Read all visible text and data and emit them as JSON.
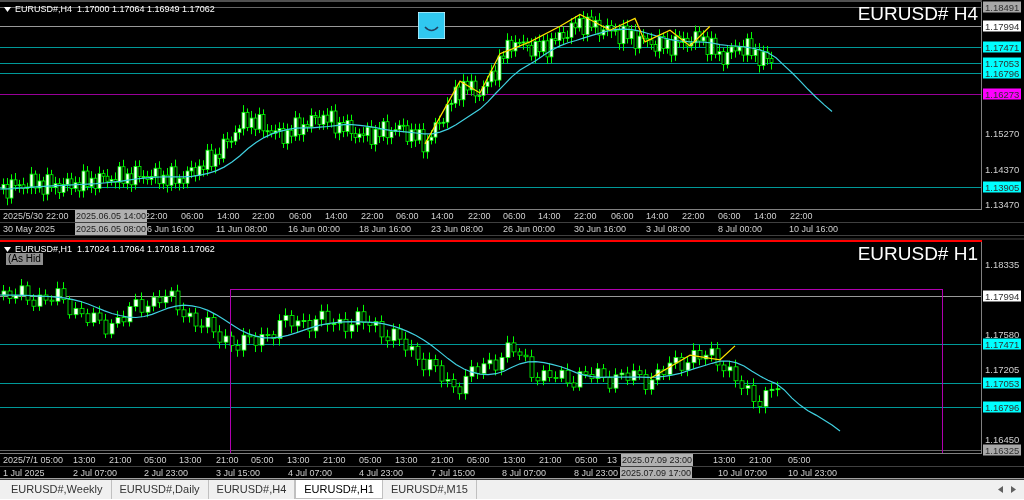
{
  "panes": [
    {
      "header": "EURUSD#,H4  1.17000 1.17064 1.16949 1.17062",
      "title": "EURUSD# H4",
      "active": false,
      "price_labels": [
        {
          "text": "1.18491",
          "kind": "box",
          "color": "#a8a8a8"
        },
        {
          "text": "1.17994",
          "kind": "box",
          "color": "#ffffff"
        },
        {
          "text": "1.17471",
          "kind": "box",
          "color": "#00ffff"
        },
        {
          "text": "1.17053",
          "kind": "box",
          "color": "#00ffff"
        },
        {
          "text": "1.16796",
          "kind": "box",
          "color": "#00ffff"
        },
        {
          "text": "1.16273",
          "kind": "box",
          "color": "#ff00ff"
        },
        {
          "text": "1.15270",
          "kind": "plain"
        },
        {
          "text": "1.14370",
          "kind": "plain"
        },
        {
          "text": "1.13905",
          "kind": "box",
          "color": "#00ffff"
        },
        {
          "text": "1.13470",
          "kind": "plain"
        }
      ],
      "time_rows": [
        [
          {
            "text": "2025/5/30",
            "kind": "plain"
          },
          {
            "text": "22:00",
            "kind": "plain"
          },
          {
            "text": "2025.06.05 14:00",
            "kind": "box"
          },
          {
            "text": "22:00",
            "kind": "plain"
          },
          {
            "text": "06:00",
            "kind": "plain"
          },
          {
            "text": "14:00",
            "kind": "plain"
          },
          {
            "text": "22:00",
            "kind": "plain"
          },
          {
            "text": "06:00",
            "kind": "plain"
          },
          {
            "text": "14:00",
            "kind": "plain"
          },
          {
            "text": "22:00",
            "kind": "plain"
          },
          {
            "text": "06:00",
            "kind": "plain"
          },
          {
            "text": "14:00",
            "kind": "plain"
          },
          {
            "text": "22:00",
            "kind": "plain"
          },
          {
            "text": "06:00",
            "kind": "plain"
          },
          {
            "text": "14:00",
            "kind": "plain"
          },
          {
            "text": "22:00",
            "kind": "plain"
          },
          {
            "text": "06:00",
            "kind": "plain"
          },
          {
            "text": "14:00",
            "kind": "plain"
          },
          {
            "text": "22:00",
            "kind": "plain"
          },
          {
            "text": "06:00",
            "kind": "plain"
          },
          {
            "text": "14:00",
            "kind": "plain"
          },
          {
            "text": "22:00",
            "kind": "plain"
          }
        ],
        [
          {
            "text": "30 May 2025",
            "kind": "plain"
          },
          {
            "text": "2025.06.05 08:00",
            "kind": "box"
          },
          {
            "text": "6 Jun 16:00",
            "kind": "plain"
          },
          {
            "text": "11 Jun 08:00",
            "kind": "plain"
          },
          {
            "text": "16 Jun 00:00",
            "kind": "plain"
          },
          {
            "text": "18 Jun 16:00",
            "kind": "plain"
          },
          {
            "text": "23 Jun 08:00",
            "kind": "plain"
          },
          {
            "text": "26 Jun 00:00",
            "kind": "plain"
          },
          {
            "text": "30 Jun 16:00",
            "kind": "plain"
          },
          {
            "text": "3 Jul 08:00",
            "kind": "plain"
          },
          {
            "text": "8 Jul 00:00",
            "kind": "plain"
          },
          {
            "text": "10 Jul 16:00",
            "kind": "plain"
          }
        ]
      ]
    },
    {
      "header": "EURUSD#,H1  1.17024 1.17064 1.17018 1.17062",
      "title": "EURUSD# H1",
      "active": true,
      "tag": "(As Hid",
      "price_labels": [
        {
          "text": "1.18335",
          "kind": "plain"
        },
        {
          "text": "1.17994",
          "kind": "box",
          "color": "#ffffff"
        },
        {
          "text": "1.17580",
          "kind": "plain"
        },
        {
          "text": "1.17471",
          "kind": "box",
          "color": "#00ffff"
        },
        {
          "text": "1.17205",
          "kind": "plain"
        },
        {
          "text": "1.17053",
          "kind": "box",
          "color": "#00ffff"
        },
        {
          "text": "1.16796",
          "kind": "box",
          "color": "#00ffff"
        },
        {
          "text": "1.16450",
          "kind": "plain"
        },
        {
          "text": "1.16325",
          "kind": "box",
          "color": "#a8a8a8"
        }
      ],
      "time_rows": [
        [
          {
            "text": "2025/7/1 05:00",
            "kind": "plain"
          },
          {
            "text": "13:00",
            "kind": "plain"
          },
          {
            "text": "21:00",
            "kind": "plain"
          },
          {
            "text": "05:00",
            "kind": "plain"
          },
          {
            "text": "13:00",
            "kind": "plain"
          },
          {
            "text": "21:00",
            "kind": "plain"
          },
          {
            "text": "05:00",
            "kind": "plain"
          },
          {
            "text": "13:00",
            "kind": "plain"
          },
          {
            "text": "21:00",
            "kind": "plain"
          },
          {
            "text": "05:00",
            "kind": "plain"
          },
          {
            "text": "13:00",
            "kind": "plain"
          },
          {
            "text": "21:00",
            "kind": "plain"
          },
          {
            "text": "05:00",
            "kind": "plain"
          },
          {
            "text": "13:00",
            "kind": "plain"
          },
          {
            "text": "21:00",
            "kind": "plain"
          },
          {
            "text": "05:00",
            "kind": "plain"
          },
          {
            "text": "13",
            "kind": "plain"
          },
          {
            "text": "2025.07.09 23:00",
            "kind": "box"
          },
          {
            "text": "13:00",
            "kind": "plain"
          },
          {
            "text": "21:00",
            "kind": "plain"
          },
          {
            "text": "05:00",
            "kind": "plain"
          }
        ],
        [
          {
            "text": "1 Jul 2025",
            "kind": "plain"
          },
          {
            "text": "2 Jul 07:00",
            "kind": "plain"
          },
          {
            "text": "2 Jul 23:00",
            "kind": "plain"
          },
          {
            "text": "3 Jul 15:00",
            "kind": "plain"
          },
          {
            "text": "4 Jul 07:00",
            "kind": "plain"
          },
          {
            "text": "4 Jul 23:00",
            "kind": "plain"
          },
          {
            "text": "7 Jul 15:00",
            "kind": "plain"
          },
          {
            "text": "8 Jul 07:00",
            "kind": "plain"
          },
          {
            "text": "8 Jul 23:00",
            "kind": "plain"
          },
          {
            "text": "2025.07.09 17:00",
            "kind": "box"
          },
          {
            "text": "10 Jul 07:00",
            "kind": "plain"
          },
          {
            "text": "10 Jul 23:00",
            "kind": "plain"
          }
        ]
      ]
    }
  ],
  "tabs": [
    {
      "label": "EURUSD#,Weekly",
      "selected": false
    },
    {
      "label": "EURUSD#,Daily",
      "selected": false
    },
    {
      "label": "EURUSD#,H4",
      "selected": false
    },
    {
      "label": "EURUSD#,H1",
      "selected": true
    },
    {
      "label": "EURUSD#,M15",
      "selected": false
    }
  ]
}
